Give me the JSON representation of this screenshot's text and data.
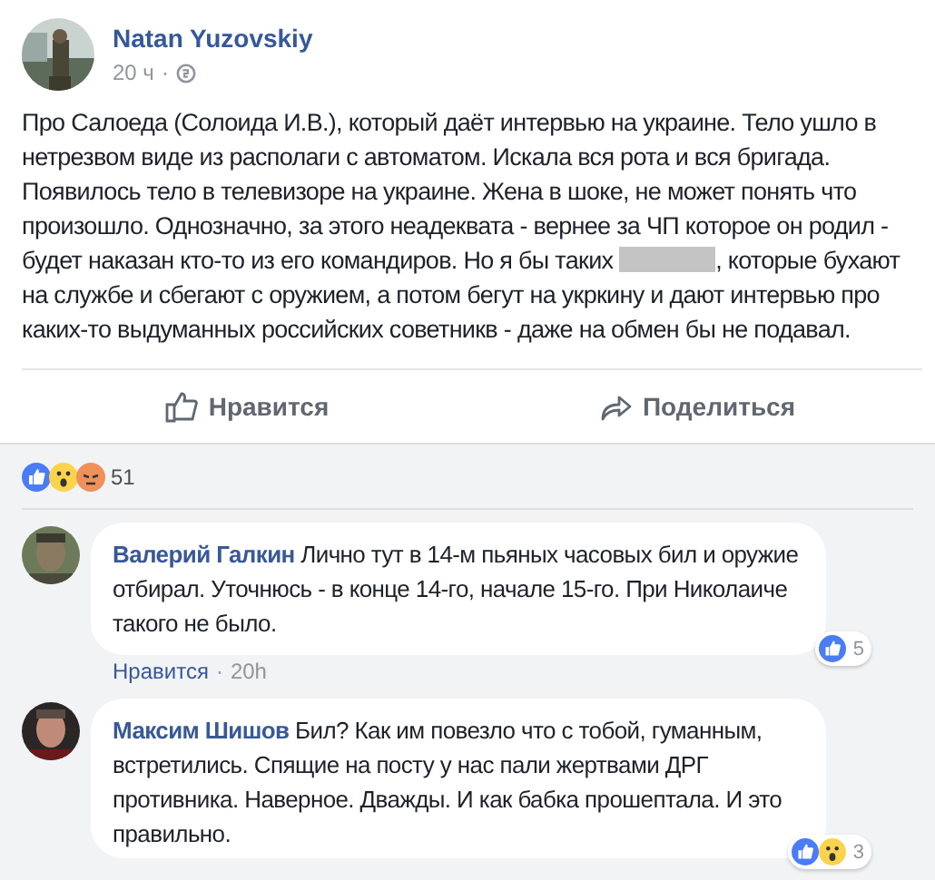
{
  "post": {
    "author": "Natan Yuzovskiy",
    "time": "20 ч",
    "separator": "·",
    "body_before": "Про Салоеда (Солоида И.В.), который даёт интервью на украине. Тело ушло в нетрезвом виде из располаги с автоматом. Искала вся рота и вся бригада. Появилось тело в телевизоре на украине. Жена в шоке, не может понять что произошло. Однозначно, за этого неадеквата - вернее за ЧП которое он родил - будет наказан кто-то из его командиров. Но я бы таких",
    "body_after": ", которые бухают на службе и сбегают с оружием, а потом бегут на укркину и дают интервью про каких-то выдуманных российских советникв - даже на обмен бы не подавал.",
    "actions": [
      {
        "kind": "like",
        "label": "Нравится"
      },
      {
        "kind": "share",
        "label": "Поделиться"
      }
    ],
    "reactions": [
      {
        "kind": "like"
      },
      {
        "kind": "wow"
      },
      {
        "kind": "angry"
      }
    ],
    "reaction_count": "51"
  },
  "comments": [
    {
      "author": "Валерий Галкин",
      "text": "Лично тут в 14-м пьяных часовых бил и оружие отбирал. Уточнюсь - в конце 14-го, начале 15-го. При Николаиче такого не было.",
      "like_label": "Нравится",
      "separator": "·",
      "time": "20h",
      "reactions": [
        {
          "kind": "like"
        }
      ],
      "reaction_count": "5"
    },
    {
      "author": "Максим Шишов",
      "text": "Бил? Как им повезло что с тобой, гуманным, встретились. Спящие на посту у нас пали жертвами ДРГ противника. Наверное. Дважды. И как бабка прошептала. И это правильно.",
      "reactions": [
        {
          "kind": "like"
        },
        {
          "kind": "wow"
        }
      ],
      "reaction_count": "3"
    }
  ]
}
